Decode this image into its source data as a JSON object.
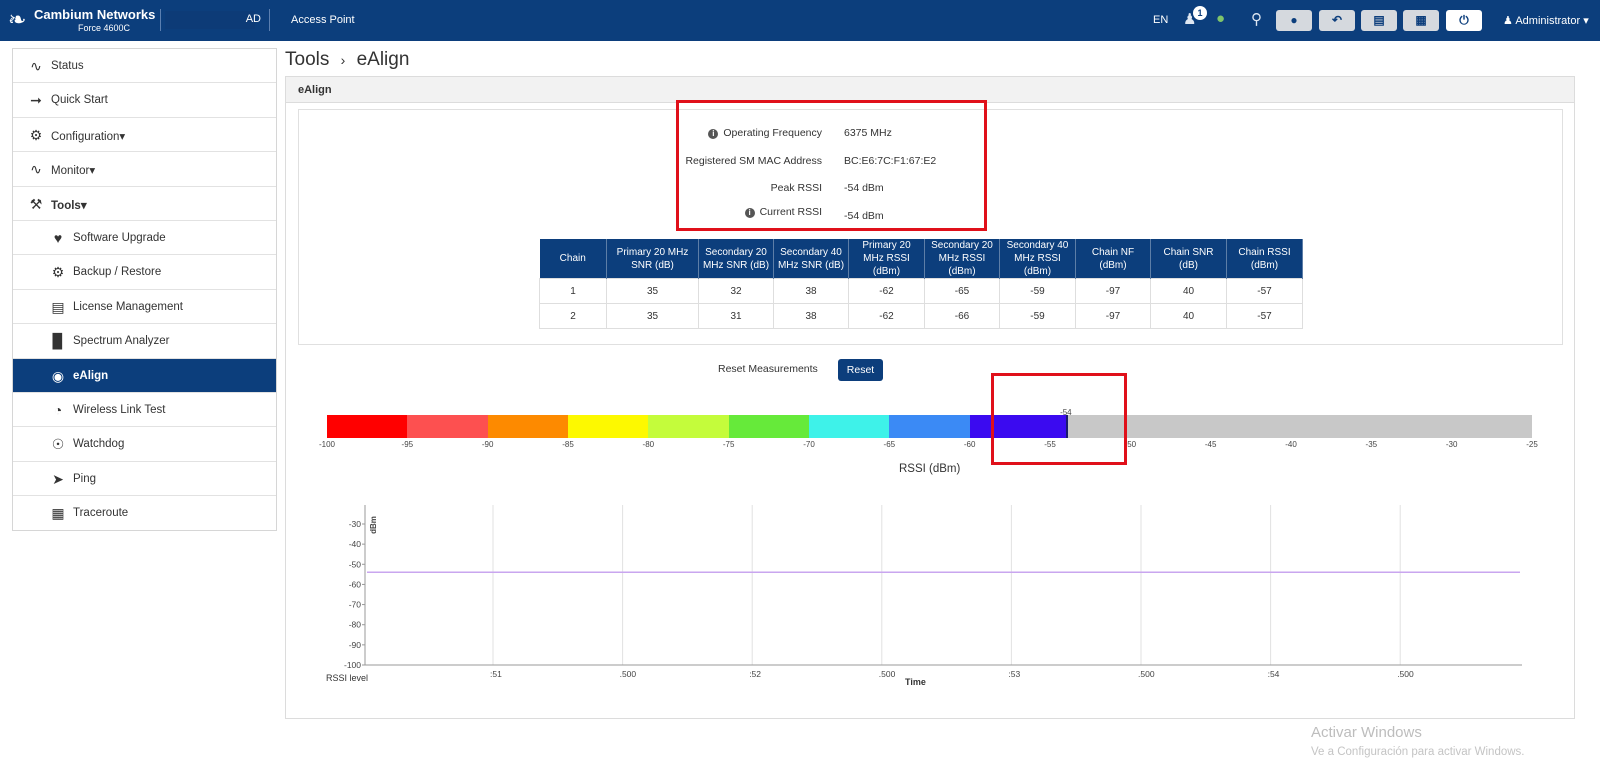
{
  "header": {
    "brand": "Cambium Networks",
    "model": "Force 4600C",
    "device_name_suffix": "AD",
    "mode": "Access Point",
    "language": "EN",
    "notification_count": "1",
    "user": "Administrator",
    "icons": [
      "user-notification-icon",
      "globe-icon",
      "location-pin-icon",
      "lightbulb-icon",
      "undo-icon",
      "save-icon",
      "reboot-icon",
      "power-icon",
      "user-icon"
    ]
  },
  "sidebar": {
    "items": [
      {
        "label": "Status",
        "icon": "status-pulse-icon"
      },
      {
        "label": "Quick Start",
        "icon": "running-man-icon"
      },
      {
        "label": "Configuration",
        "icon": "gear-icon"
      },
      {
        "label": "Monitor",
        "icon": "monitor-pulse-icon"
      },
      {
        "label": "Tools",
        "icon": "wrench-icon"
      },
      {
        "label": "Software Upgrade",
        "icon": "software-upgrade-icon"
      },
      {
        "label": "Backup / Restore",
        "icon": "backup-restore-icon"
      },
      {
        "label": "License Management",
        "icon": "license-icon"
      },
      {
        "label": "Spectrum Analyzer",
        "icon": "bar-chart-icon"
      },
      {
        "label": "eAlign",
        "icon": "ealign-icon"
      },
      {
        "label": "Wireless Link Test",
        "icon": "speedometer-icon"
      },
      {
        "label": "Watchdog",
        "icon": "eye-icon"
      },
      {
        "label": "Ping",
        "icon": "ping-icon"
      },
      {
        "label": "Traceroute",
        "icon": "traceroute-icon"
      }
    ]
  },
  "breadcrumb": {
    "parent": "Tools",
    "separator": "›",
    "current": "eAlign"
  },
  "panel": {
    "title": "eAlign"
  },
  "info": {
    "operating_frequency_label": "Operating Frequency",
    "operating_frequency_value": "6375 MHz",
    "registered_sm_mac_label": "Registered SM MAC Address",
    "registered_sm_mac_value": "BC:E6:7C:F1:67:E2",
    "peak_rssi_label": "Peak RSSI",
    "peak_rssi_value": "-54 dBm",
    "current_rssi_label": "Current RSSI",
    "current_rssi_value": "-54 dBm"
  },
  "chain_table": {
    "headers": [
      "Chain",
      "Primary 20 MHz SNR (dB)",
      "Secondary 20 MHz SNR (dB)",
      "Secondary 40 MHz SNR (dB)",
      "Primary 20 MHz RSSI (dBm)",
      "Secondary 20 MHz RSSI (dBm)",
      "Secondary 40 MHz RSSI (dBm)",
      "Chain NF (dBm)",
      "Chain SNR (dB)",
      "Chain RSSI (dBm)"
    ],
    "rows": [
      [
        "1",
        "35",
        "32",
        "38",
        "-62",
        "-65",
        "-59",
        "-97",
        "40",
        "-57"
      ],
      [
        "2",
        "35",
        "31",
        "38",
        "-62",
        "-66",
        "-59",
        "-97",
        "40",
        "-57"
      ]
    ]
  },
  "reset": {
    "label": "Reset Measurements",
    "button": "Reset"
  },
  "rssi_scale": {
    "title": "RSSI (dBm)",
    "min": -100,
    "max": -25,
    "current": -54,
    "current_label": "-54",
    "ticks": [
      "-100",
      "-95",
      "-90",
      "-85",
      "-80",
      "-75",
      "-70",
      "-65",
      "-60",
      "-55",
      "-50",
      "-45",
      "-40",
      "-35",
      "-30",
      "-25"
    ],
    "segments": [
      {
        "from": -100,
        "to": -95,
        "color": "#ff0000"
      },
      {
        "from": -95,
        "to": -90,
        "color": "#fd5050"
      },
      {
        "from": -90,
        "to": -85,
        "color": "#fd8a00"
      },
      {
        "from": -85,
        "to": -80,
        "color": "#fdf900"
      },
      {
        "from": -80,
        "to": -75,
        "color": "#c4fc3b"
      },
      {
        "from": -75,
        "to": -70,
        "color": "#66ea3a"
      },
      {
        "from": -70,
        "to": -65,
        "color": "#3ef2e9"
      },
      {
        "from": -65,
        "to": -60,
        "color": "#3b8af5"
      },
      {
        "from": -60,
        "to": -54,
        "color": "#3b0af0"
      }
    ]
  },
  "chart_data": {
    "type": "line",
    "xlabel": "Time",
    "ylabel": "dBm",
    "ylim": [
      -100,
      -30
    ],
    "yticks": [
      "-30",
      "-40",
      "-50",
      "-60",
      "-70",
      "-80",
      "-90",
      "-100"
    ],
    "xticks": [
      ":51",
      ".500",
      ":52",
      ".500",
      ":53",
      ".500",
      ":54",
      ".500"
    ],
    "grid": true,
    "legend": "bottom-left",
    "series": [
      {
        "name": "RSSI level",
        "color": "#c9a6ef",
        "legend_color": "#3d7dc8",
        "values": [
          -54,
          -54,
          -54,
          -54,
          -54,
          -54,
          -54,
          -54,
          -54
        ]
      }
    ]
  },
  "watermark": {
    "line1": "Activar Windows",
    "line2": "Ve a Configuración para activar Windows."
  }
}
